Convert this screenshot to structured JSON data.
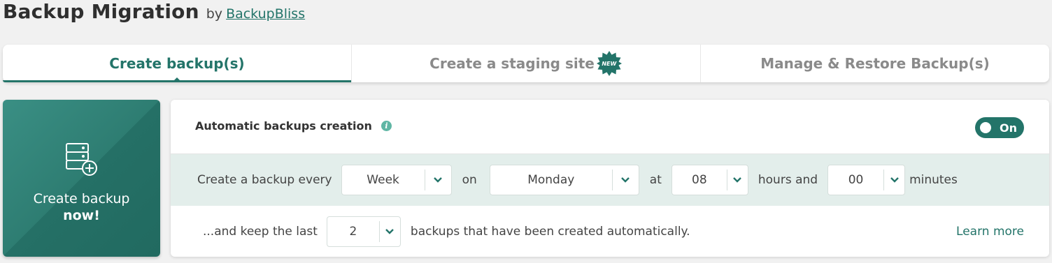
{
  "header": {
    "title": "Backup Migration",
    "by_label": "by",
    "brand_link": "BackupBliss"
  },
  "tabs": [
    {
      "label": "Create backup(s)",
      "active": true
    },
    {
      "label": "Create a staging site",
      "badge": "NEW"
    },
    {
      "label": "Manage & Restore Backup(s)"
    }
  ],
  "create_now": {
    "line1": "Create backup",
    "line2": "now!",
    "icon": "server-plus-icon"
  },
  "auto_backup": {
    "title": "Automatic backups creation",
    "info_icon": "info-icon",
    "toggle_label": "On",
    "toggle_on": true,
    "schedule": {
      "prefix": "Create a backup every",
      "period": "Week",
      "on_label": "on",
      "day": "Monday",
      "at_label": "at",
      "hour": "08",
      "hours_label": "hours and",
      "minute": "00",
      "minutes_label": "minutes"
    },
    "retention": {
      "prefix": "...and keep the last",
      "count": "2",
      "suffix": "backups that have been created automatically.",
      "learn_more": "Learn more"
    }
  },
  "colors": {
    "accent": "#237469",
    "page_bg": "#f1f1f1",
    "row_highlight": "#e3eeeb",
    "info": "#5fb6a4"
  }
}
